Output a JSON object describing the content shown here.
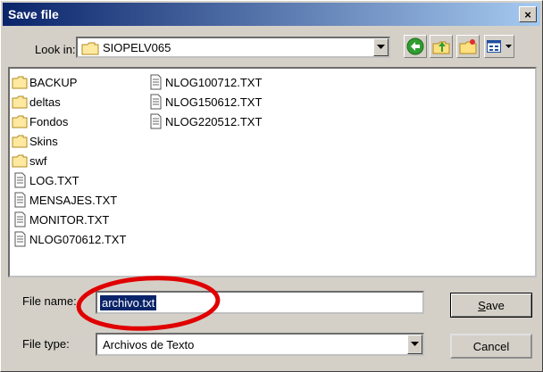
{
  "window": {
    "title": "Save file",
    "close_glyph": "×"
  },
  "lookin": {
    "label": "Look in:",
    "folder": "SIOPELV065",
    "folder_icon": "folder-icon"
  },
  "toolbar": [
    {
      "name": "back-button",
      "icon": "green-back-arrow-icon"
    },
    {
      "name": "up-folder-button",
      "icon": "up-folder-icon"
    },
    {
      "name": "new-folder-button",
      "icon": "new-folder-icon"
    },
    {
      "name": "view-menu-button",
      "icon": "view-list-icon"
    }
  ],
  "files": {
    "column1": [
      {
        "name": "BACKUP",
        "type": "folder"
      },
      {
        "name": "deltas",
        "type": "folder"
      },
      {
        "name": "Fondos",
        "type": "folder"
      },
      {
        "name": "Skins",
        "type": "folder"
      },
      {
        "name": "swf",
        "type": "folder"
      },
      {
        "name": "LOG.TXT",
        "type": "text"
      },
      {
        "name": "MENSAJES.TXT",
        "type": "text"
      },
      {
        "name": "MONITOR.TXT",
        "type": "text"
      },
      {
        "name": "NLOG070612.TXT",
        "type": "text"
      }
    ],
    "column2": [
      {
        "name": "NLOG100712.TXT",
        "type": "text"
      },
      {
        "name": "NLOG150612.TXT",
        "type": "text"
      },
      {
        "name": "NLOG220512.TXT",
        "type": "text"
      }
    ]
  },
  "filename": {
    "label": "File name:",
    "value": "archivo.txt"
  },
  "filetype": {
    "label": "File type:",
    "value": "Archivos de Texto"
  },
  "buttons": {
    "save": "Save",
    "cancel": "Cancel"
  },
  "colors": {
    "title_bar": "#0a246a",
    "selection": "#0a246a",
    "annotation": "#e00000"
  }
}
